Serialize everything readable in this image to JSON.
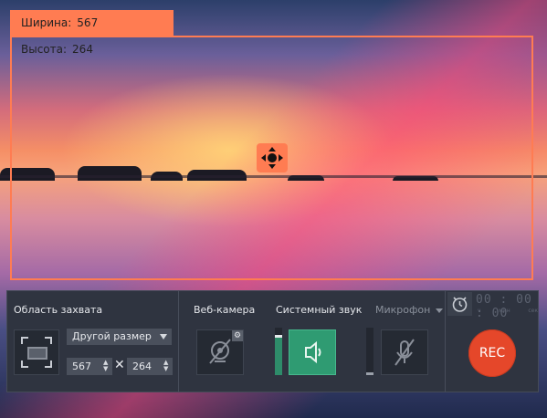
{
  "capture": {
    "width_label": "Ширина:",
    "width_value": "567",
    "height_label": "Высота:",
    "height_value": "264"
  },
  "panel": {
    "area_title": "Область захвата",
    "size_select_value": "Другой размер",
    "width_input": "567",
    "height_input": "264",
    "times_symbol": "✕",
    "webcam_title": "Веб-камера",
    "sound_title": "Системный звук",
    "mic_title": "Микрофон",
    "timer_display": "00 : 00 : 00",
    "timer_units": [
      "ч",
      "мин",
      "сек"
    ],
    "rec_label": "REC",
    "sound_volume": 0.85,
    "mic_volume": 0.05
  },
  "icons": {
    "move": "move-arrows-icon",
    "area": "capture-area-icon",
    "webcam": "webcam-off-icon",
    "gear": "gear-icon",
    "speaker": "speaker-icon",
    "mic": "microphone-off-icon",
    "alarm": "alarm-clock-icon"
  },
  "colors": {
    "accent": "#ff7c52",
    "panel": "#2f3440",
    "sound_active": "#2f9b72",
    "rec": "#e5472a"
  }
}
